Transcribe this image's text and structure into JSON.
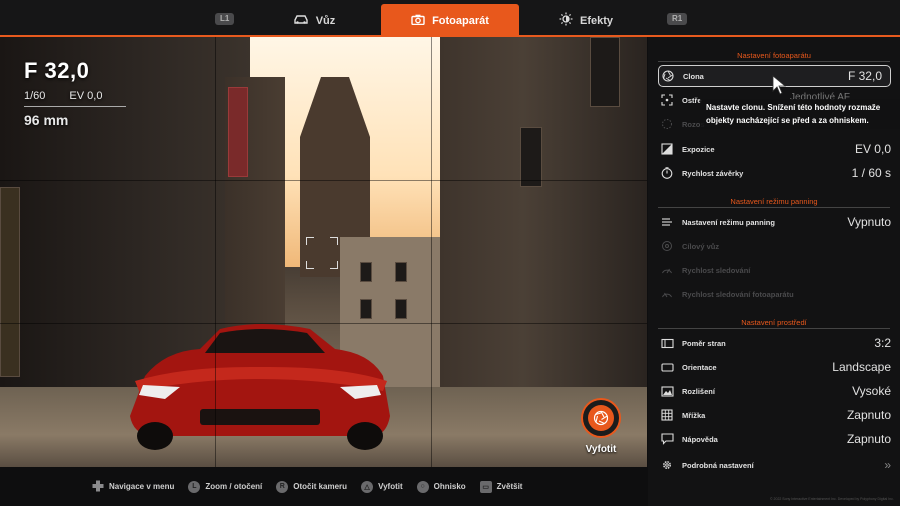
{
  "topbar": {
    "left_shoulder": "L1",
    "right_shoulder": "R1",
    "tabs": [
      {
        "label": "Vůz",
        "icon": "car-icon",
        "active": false
      },
      {
        "label": "Fotoaparát",
        "icon": "camera-icon",
        "active": true
      },
      {
        "label": "Efekty",
        "icon": "sun-icon",
        "active": false
      }
    ]
  },
  "readout": {
    "aperture": "F 32,0",
    "shutter": "1/60",
    "ev": "EV 0,0",
    "focal_length": "96 mm"
  },
  "shutter_button": {
    "label": "Vyfotit"
  },
  "panel": {
    "camera_section": {
      "title": "Nastavení fotoaparátu",
      "rows": [
        {
          "label": "Clona",
          "value": "F 32,0",
          "icon": "aperture-icon",
          "selected": true
        },
        {
          "label": "Ostře",
          "value": "",
          "icon": "focus-icon"
        },
        {
          "label": "Rozos",
          "value": "",
          "icon": "blur-icon",
          "dim": true
        },
        {
          "label": "Expozice",
          "value": "EV 0,0",
          "icon": "exposure-icon"
        },
        {
          "label": "Rychlost závěrky",
          "value": "1 / 60 s",
          "icon": "timer-icon"
        }
      ]
    },
    "panning_section": {
      "title": "Nastavení režimu panning",
      "rows": [
        {
          "label": "Nastavení režimu panning",
          "value": "Vypnuto",
          "icon": "panning-icon"
        },
        {
          "label": "Cílový vůz",
          "value": "",
          "icon": "target-car-icon",
          "dim": true
        },
        {
          "label": "Rychlost sledování",
          "value": "",
          "icon": "speed-icon",
          "dim": true
        },
        {
          "label": "Rychlost sledování fotoaparátu",
          "value": "",
          "icon": "camera-speed-icon",
          "dim": true
        }
      ]
    },
    "environment_section": {
      "title": "Nastavení prostředí",
      "rows": [
        {
          "label": "Poměr stran",
          "value": "3:2",
          "icon": "aspect-ratio-icon"
        },
        {
          "label": "Orientace",
          "value": "Landscape",
          "icon": "orientation-icon"
        },
        {
          "label": "Rozlišení",
          "value": "Vysoké",
          "icon": "resolution-icon"
        },
        {
          "label": "Mřížka",
          "value": "Zapnuto",
          "icon": "grid-icon"
        },
        {
          "label": "Nápověda",
          "value": "Zapnuto",
          "icon": "help-icon"
        },
        {
          "label": "Podrobná nastavení",
          "value": "»",
          "icon": "gear-icon"
        }
      ]
    },
    "tooltip": "Nastavte clonu. Snížení této hodnoty rozmaže objekty nacházející se před a za ohniskem.",
    "obscured_value": "Jednotlivé AF"
  },
  "bottombar": {
    "hints": [
      {
        "label": "Navigace v menu",
        "icon": "dpad-icon"
      },
      {
        "label": "Zoom / otočení",
        "icon": "left-stick-icon",
        "glyph": "L"
      },
      {
        "label": "Otočit kameru",
        "icon": "right-stick-icon",
        "glyph": "R"
      },
      {
        "label": "Vyfotit",
        "icon": "triangle-button-icon",
        "glyph": "△"
      },
      {
        "label": "Ohnisko",
        "icon": "circle-button-icon",
        "glyph": "○"
      },
      {
        "label": "Zvětšit",
        "icon": "touchpad-icon",
        "glyph": "▭"
      }
    ]
  },
  "footer": {
    "copyright": "© 2022 Sony Interactive Entertainment Inc. Developed by Polyphony Digital Inc."
  },
  "colors": {
    "accent": "#e8581c",
    "panel_bg": "#121213",
    "text": "#e2e2e2",
    "dim": "#4a4a4c"
  }
}
